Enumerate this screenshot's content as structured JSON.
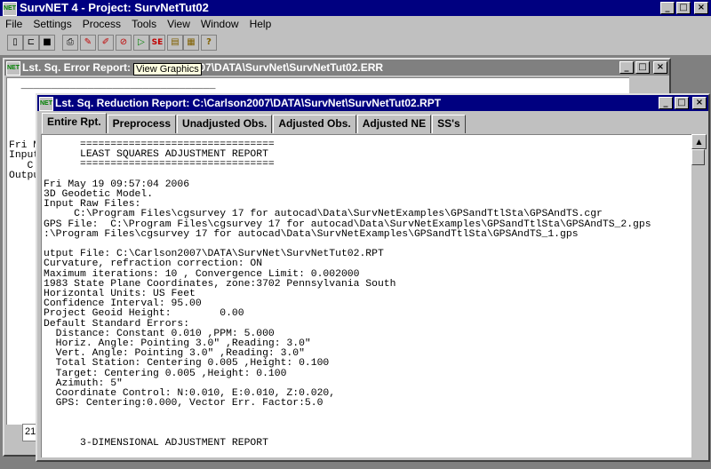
{
  "app": {
    "title": "SurvNET 4 - Project: SurvNetTut02",
    "icon_text": "NET"
  },
  "menu": [
    "File",
    "Settings",
    "Process",
    "Tools",
    "View",
    "Window",
    "Help"
  ],
  "toolbar": {
    "buttons": [
      {
        "name": "new-icon",
        "glyph": "▯"
      },
      {
        "name": "open-icon",
        "glyph": "⊏"
      },
      {
        "name": "save-icon",
        "glyph": "■"
      },
      {
        "name": "print-icon",
        "glyph": "⎙"
      },
      {
        "name": "edit-icon",
        "glyph": "✎"
      },
      {
        "name": "pen-icon",
        "glyph": "✐"
      },
      {
        "name": "stop-icon",
        "glyph": "⊘"
      },
      {
        "name": "run-icon",
        "glyph": "▷"
      },
      {
        "name": "se-icon",
        "glyph": "SE"
      },
      {
        "name": "report-icon",
        "glyph": "▤"
      },
      {
        "name": "graph-icon",
        "glyph": "▦"
      },
      {
        "name": "help-icon",
        "glyph": "?"
      }
    ]
  },
  "tooltip": "View Graphics",
  "error_window": {
    "title": "Lst. Sq. Error Report: C:\\Carlson2007\\DATA\\SurvNet\\SurvNetTut02.ERR",
    "text": "  ________________________________\n\n\n\n\n\nFri M\nInput\n   C\nOutpu",
    "status_value": "21"
  },
  "report_window": {
    "title": "Lst. Sq. Reduction Report: C:\\Carlson2007\\DATA\\SurvNet\\SurvNetTut02.RPT",
    "tabs": [
      "Entire Rpt.",
      "Preprocess",
      "Unadjusted Obs.",
      "Adjusted Obs.",
      "Adjusted NE",
      "SS's"
    ],
    "text": "      ================================\n      LEAST SQUARES ADJUSTMENT REPORT\n      ================================\n\nFri May 19 09:57:04 2006\n3D Geodetic Model.\nInput Raw Files:\n     C:\\Program Files\\cgsurvey 17 for autocad\\Data\\SurvNetExamples\\GPSandTtlSta\\GPSAndTS.cgr\nGPS File:  C:\\Program Files\\cgsurvey 17 for autocad\\Data\\SurvNetExamples\\GPSandTtlSta\\GPSAndTS_2.gps\n:\\Program Files\\cgsurvey 17 for autocad\\Data\\SurvNetExamples\\GPSandTtlSta\\GPSAndTS_1.gps\n\nutput File: C:\\Carlson2007\\DATA\\SurvNet\\SurvNetTut02.RPT\nCurvature, refraction correction: ON\nMaximum iterations: 10 , Convergence Limit: 0.002000\n1983 State Plane Coordinates, zone:3702 Pennsylvania South\nHorizontal Units: US Feet\nConfidence Interval: 95.00\nProject Geoid Height:        0.00\nDefault Standard Errors:\n  Distance: Constant 0.010 ,PPM: 5.000\n  Horiz. Angle: Pointing 3.0\" ,Reading: 3.0\"\n  Vert. Angle: Pointing 3.0\" ,Reading: 3.0\"\n  Total Station: Centering 0.005 ,Height: 0.100\n  Target: Centering 0.005 ,Height: 0.100\n  Azimuth: 5\"\n  Coordinate Control: N:0.010, E:0.010, Z:0.020,\n  GPS: Centering:0.000, Vector Err. Factor:5.0\n\n\n\n      3-DIMENSIONAL ADJUSTMENT REPORT"
  },
  "window_buttons": {
    "minimize": "_",
    "maximize": "□",
    "close": "×"
  },
  "colors": {
    "titlebar_active": "#000080",
    "titlebar_inactive": "#808080",
    "window_face": "#c0c0c0",
    "tooltip_bg": "#ffffe1"
  }
}
